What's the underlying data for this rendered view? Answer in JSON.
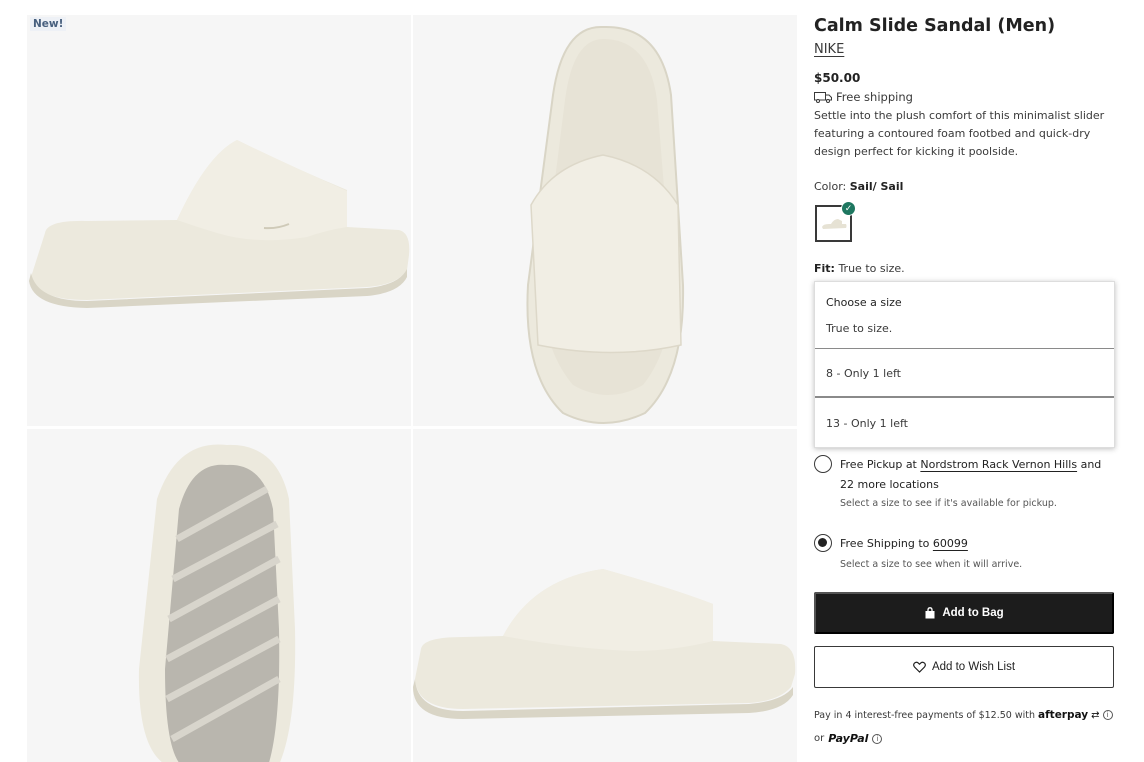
{
  "gallery": {
    "badge": "New!",
    "images": [
      {
        "alt": "side view sandal"
      },
      {
        "alt": "top view sandal"
      },
      {
        "alt": "sole view sandal"
      },
      {
        "alt": "side view sandal 2"
      }
    ]
  },
  "product": {
    "title": "Calm Slide Sandal (Men)",
    "brand": "NIKE",
    "price": "$50.00",
    "shipping": "Free shipping",
    "description": "Settle into the plush comfort of this minimalist slider featuring a contoured foam footbed and quick-dry design perfect for kicking it poolside.",
    "color_label": "Color:",
    "color_value": "Sail/ Sail",
    "fit_label": "Fit:",
    "fit_value": "True to size."
  },
  "size_dropdown": {
    "title": "Choose a size",
    "subtitle": "True to size.",
    "options": [
      "8 - Only 1 left",
      "13 - Only 1 left"
    ]
  },
  "delivery": {
    "pickup_prefix": "Free Pickup at",
    "pickup_store": "Nordstrom Rack Vernon Hills",
    "pickup_suffix": "and 22 more locations",
    "pickup_note": "Select a size to see if it's available for pickup.",
    "shipping_prefix": "Free Shipping to",
    "shipping_zip": "60099",
    "shipping_note": "Select a size to see when it will arrive.",
    "selected": "shipping"
  },
  "actions": {
    "add_to_bag": "Add to Bag",
    "add_to_wishlist": "Add to Wish List"
  },
  "payments": {
    "afterpay_text": "Pay in 4 interest-free payments of $12.50 with",
    "afterpay_brand": "afterpay",
    "or": "or",
    "paypal_brand": "PayPal"
  },
  "colors": {
    "accent": "#1e7760",
    "button_dark": "#1c1c1c",
    "sandal": "#ece9dd"
  }
}
